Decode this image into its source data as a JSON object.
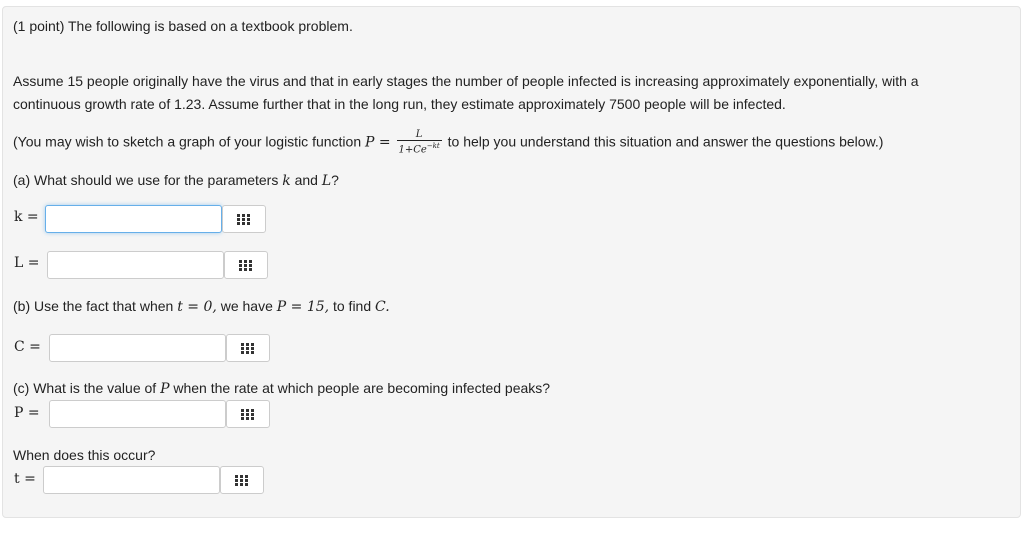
{
  "problem": {
    "header": "(1 point) The following is based on a textbook problem.",
    "intro_line1": "Assume 15 people originally have the virus and that in early stages the number of people infected is increasing approximately exponentially, with a",
    "intro_line2": "continuous growth rate of 1.23. Assume further that in the long run, they estimate approximately 7500 people will be infected.",
    "hint_prefix": "(You may wish to sketch a graph of your logistic function",
    "hint_suffix": "to help you understand this situation and answer the questions below.)",
    "formula": {
      "lhs": "P =",
      "numerator": "L",
      "denominator": "1+Ce",
      "exponent": "−kt"
    },
    "part_a": {
      "prefix": "(a) What should we use for the parameters",
      "var1": "k",
      "and": "and",
      "var2": "L",
      "suffix": "?"
    },
    "part_b": {
      "prefix": "(b) Use the fact that when",
      "cond1": "t = 0,",
      "middle": "we have",
      "cond2": "P = 15,",
      "suffix": "to find",
      "target": "C."
    },
    "part_c": {
      "prefix": "(c) What is the value of",
      "var": "P",
      "suffix": "when the rate at which people are becoming infected peaks?"
    },
    "when": "When does this occur?"
  },
  "answers": [
    {
      "label": "k =",
      "value": "",
      "placeholder": ""
    },
    {
      "label": "L =",
      "value": "",
      "placeholder": ""
    },
    {
      "label": "C =",
      "value": "",
      "placeholder": ""
    },
    {
      "label": "P =",
      "value": "",
      "placeholder": ""
    },
    {
      "label": "t =",
      "value": "",
      "placeholder": ""
    }
  ],
  "icons": {
    "keypad": "keypad-grid-icon"
  }
}
